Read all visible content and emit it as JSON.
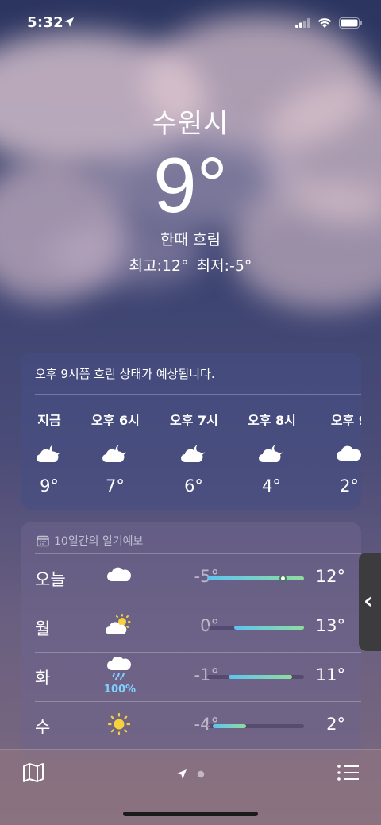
{
  "status_bar": {
    "time": "5:32",
    "icons": [
      "location-arrow-icon",
      "cellular-signal-icon",
      "wifi-icon",
      "battery-icon"
    ]
  },
  "current": {
    "city": "수원시",
    "temperature": "9°",
    "condition": "한때 흐림",
    "high_low": "최고:12°  최저:-5°"
  },
  "hourly": {
    "summary": "오후 9시쯤 흐린 상태가 예상됩니다.",
    "hours": [
      {
        "label": "지금",
        "icon": "partly-cloudy-night-icon",
        "temp": "9°"
      },
      {
        "label": "오후 6시",
        "icon": "partly-cloudy-night-icon",
        "temp": "7°"
      },
      {
        "label": "오후 7시",
        "icon": "partly-cloudy-night-icon",
        "temp": "6°"
      },
      {
        "label": "오후 8시",
        "icon": "partly-cloudy-night-icon",
        "temp": "4°"
      },
      {
        "label": "오후 9",
        "icon": "cloud-icon",
        "temp": "2°"
      }
    ]
  },
  "daily": {
    "header": "10일간의 일기예보",
    "days": [
      {
        "name": "오늘",
        "icon": "cloud-icon",
        "precip": "",
        "low": "-5°",
        "high": "12°",
        "range_start": 0.0,
        "range_end": 1.0,
        "current_position": 0.78
      },
      {
        "name": "월",
        "icon": "partly-sunny-icon",
        "precip": "",
        "low": "0°",
        "high": "13°",
        "range_start": 0.28,
        "range_end": 1.0
      },
      {
        "name": "화",
        "icon": "rain-cloud-icon",
        "precip": "100%",
        "low": "-1°",
        "high": "11°",
        "range_start": 0.22,
        "range_end": 0.88
      },
      {
        "name": "수",
        "icon": "sun-icon",
        "precip": "",
        "low": "-4°",
        "high": "2°",
        "range_start": 0.06,
        "range_end": 0.4
      }
    ]
  },
  "bottom_bar": {
    "icons": [
      "map-icon",
      "location-page-icon",
      "page-dot-icon",
      "list-icon"
    ]
  },
  "colors": {
    "range_blue": "#5ec4f0",
    "range_green": "#8fdca0",
    "sun_yellow": "#f7d13a",
    "precip_blue": "#7fd0ff"
  }
}
